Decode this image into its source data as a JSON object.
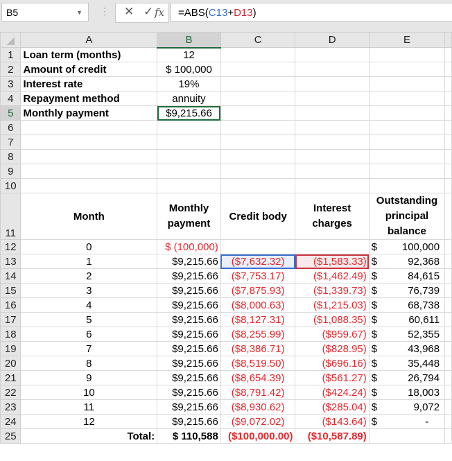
{
  "namebox": "B5",
  "formula": {
    "prefix": "=ABS(",
    "ref1": "C13",
    "op": "+",
    "ref2": "D13",
    "suffix": ")"
  },
  "icons": {
    "cancel": "✕",
    "enter": "✓",
    "fx": "fx"
  },
  "columns": [
    "A",
    "B",
    "C",
    "D",
    "E"
  ],
  "params": [
    {
      "row": "1",
      "label": "Loan term (months)",
      "value": "12"
    },
    {
      "row": "2",
      "label": "Amount of credit",
      "value": "$ 100,000"
    },
    {
      "row": "3",
      "label": "Interest rate",
      "value": "19%"
    },
    {
      "row": "4",
      "label": "Repayment method",
      "value": "annuity"
    },
    {
      "row": "5",
      "label": "Monthly payment",
      "value": "$9,215.66"
    }
  ],
  "empty_rows": [
    "6",
    "7",
    "8",
    "9",
    "10"
  ],
  "table_header": {
    "row": "11",
    "month": "Month",
    "payment": "Monthly payment",
    "body": "Credit body",
    "interest": "Interest charges",
    "balance": "Outstanding principal balance"
  },
  "rows": [
    {
      "row": "12",
      "month": "0",
      "payment": "$ (100,000)",
      "body": "",
      "interest": "",
      "cur": "$",
      "balance": "100,000"
    },
    {
      "row": "13",
      "month": "1",
      "payment": "$9,215.66",
      "body": "($7,632.32)",
      "interest": "($1,583.33)",
      "cur": "$",
      "balance": "92,368"
    },
    {
      "row": "14",
      "month": "2",
      "payment": "$9,215.66",
      "body": "($7,753.17)",
      "interest": "($1,462.49)",
      "cur": "$",
      "balance": "84,615"
    },
    {
      "row": "15",
      "month": "3",
      "payment": "$9,215.66",
      "body": "($7,875.93)",
      "interest": "($1,339.73)",
      "cur": "$",
      "balance": "76,739"
    },
    {
      "row": "16",
      "month": "4",
      "payment": "$9,215.66",
      "body": "($8,000.63)",
      "interest": "($1,215.03)",
      "cur": "$",
      "balance": "68,738"
    },
    {
      "row": "17",
      "month": "5",
      "payment": "$9,215.66",
      "body": "($8,127.31)",
      "interest": "($1,088.35)",
      "cur": "$",
      "balance": "60,611"
    },
    {
      "row": "18",
      "month": "6",
      "payment": "$9,215.66",
      "body": "($8,255.99)",
      "interest": "($959.67)",
      "cur": "$",
      "balance": "52,355"
    },
    {
      "row": "19",
      "month": "7",
      "payment": "$9,215.66",
      "body": "($8,386.71)",
      "interest": "($828.95)",
      "cur": "$",
      "balance": "43,968"
    },
    {
      "row": "20",
      "month": "8",
      "payment": "$9,215.66",
      "body": "($8,519.50)",
      "interest": "($696.16)",
      "cur": "$",
      "balance": "35,448"
    },
    {
      "row": "21",
      "month": "9",
      "payment": "$9,215.66",
      "body": "($8,654.39)",
      "interest": "($561.27)",
      "cur": "$",
      "balance": "26,794"
    },
    {
      "row": "22",
      "month": "10",
      "payment": "$9,215.66",
      "body": "($8,791.42)",
      "interest": "($424.24)",
      "cur": "$",
      "balance": "18,003"
    },
    {
      "row": "23",
      "month": "11",
      "payment": "$9,215.66",
      "body": "($8,930.62)",
      "interest": "($285.04)",
      "cur": "$",
      "balance": "9,072"
    },
    {
      "row": "24",
      "month": "12",
      "payment": "$9,215.66",
      "body": "($9,072.02)",
      "interest": "($143.64)",
      "cur": "$",
      "balance": "-"
    }
  ],
  "total": {
    "row": "25",
    "label": "Total:",
    "payment": "$ 110,588",
    "body": "($100,000.00)",
    "interest": "($10,587.89)"
  }
}
